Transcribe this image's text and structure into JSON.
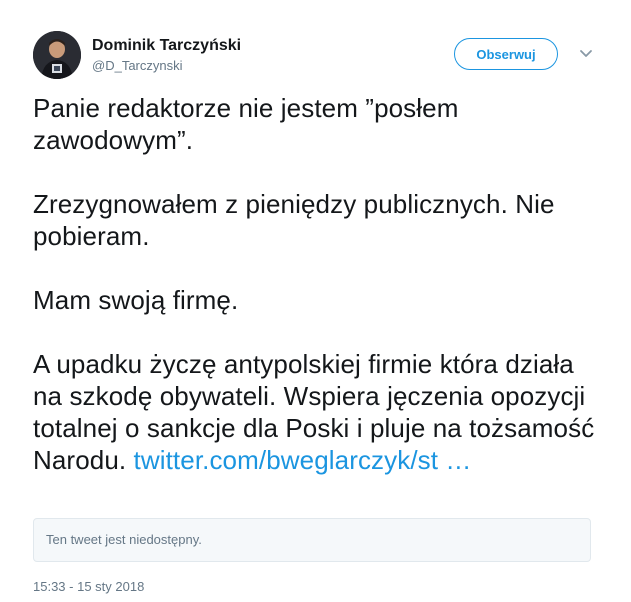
{
  "author": {
    "name": "Dominik Tarczyński",
    "handle": "@D_Tarczynski"
  },
  "follow_button": {
    "label": "Obserwuj"
  },
  "tweet": {
    "paragraphs": [
      "Panie redaktorze nie jestem ”posłem zawodowym”.",
      "Zrezygnowałem z pieniędzy publicznych. Nie pobieram.",
      "Mam swoją firmę."
    ],
    "last_paragraph_text": "A upadku życzę antypolskiej firmie która działa na szkodę obywateli. Wspiera jęczenia opozycji totalnej o sankcje dla Poski i pluje na tożsamość Narodu. ",
    "link_text": "twitter.com/bweglarczyk/st …"
  },
  "quoted_tweet": {
    "text": "Ten tweet jest niedostępny."
  },
  "timestamp": "15:33 - 15 sty 2018",
  "icons": {
    "more": "chevron-down-icon"
  },
  "colors": {
    "accent": "#1b95e0",
    "text": "#14171a",
    "secondary": "#657786",
    "card_border": "#e1e8ed",
    "card_bg": "#f5f8fa"
  }
}
